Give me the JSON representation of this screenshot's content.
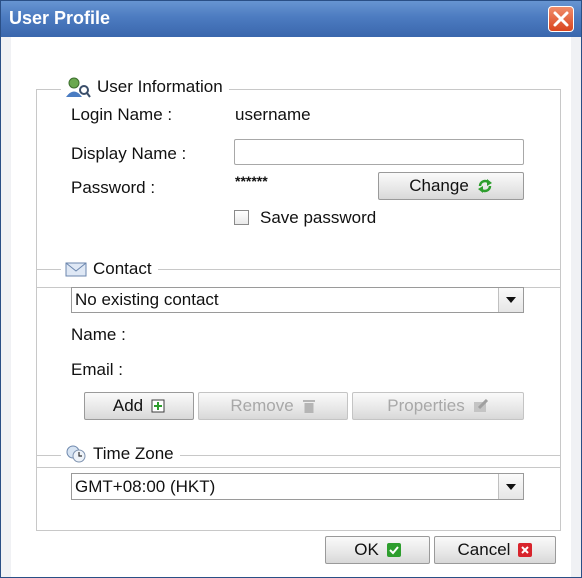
{
  "window": {
    "title": "User Profile"
  },
  "user_info": {
    "legend": "User Information",
    "login_label": "Login Name :",
    "login_value": "username",
    "display_label": "Display Name :",
    "display_value": "",
    "password_label": "Password :",
    "password_value": "******",
    "change_button": "Change",
    "save_password_label": "Save password",
    "save_password_checked": false
  },
  "contact": {
    "legend": "Contact",
    "selected": "No existing contact",
    "name_label": "Name :",
    "email_label": "Email :",
    "add_button": "Add",
    "remove_button": "Remove",
    "properties_button": "Properties"
  },
  "timezone": {
    "legend": "Time Zone",
    "selected": "GMT+08:00 (HKT)"
  },
  "footer": {
    "ok_button": "OK",
    "cancel_button": "Cancel"
  },
  "colors": {
    "titlebar": "#4c7bc0",
    "ok_green": "#2e9e2e",
    "cancel_red": "#d8242c"
  }
}
